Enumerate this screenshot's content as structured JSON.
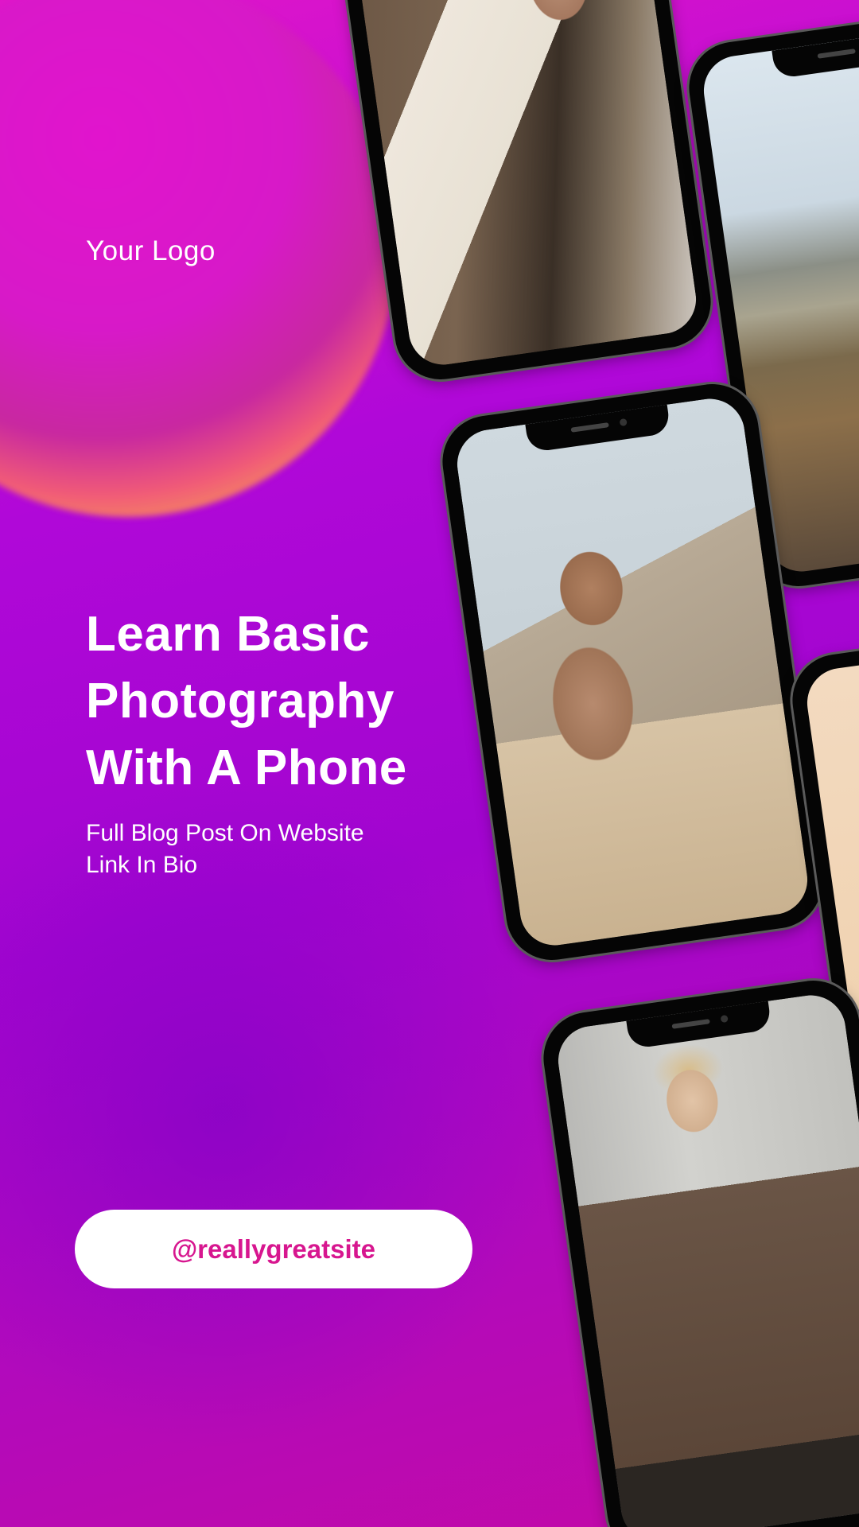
{
  "brand": {
    "logo_text": "Your Logo"
  },
  "headline": {
    "lines": [
      "Learn Basic",
      "Photography",
      "With A Phone"
    ]
  },
  "subtitle": {
    "lines": [
      "Full Blog Post On Website",
      "Link In Bio"
    ]
  },
  "cta": {
    "handle": "@reallygreatsite"
  },
  "colors": {
    "background_top": "#e016c9",
    "background_mid": "#a205cf",
    "background_bottom": "#c309a6",
    "orb_glow": "#f3a05a",
    "text": "#ffffff",
    "cta_text": "#d7168f",
    "cta_background": "#ffffff",
    "phone_frame": "#050505"
  }
}
